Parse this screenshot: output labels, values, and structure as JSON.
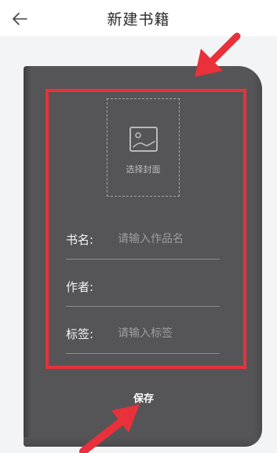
{
  "header": {
    "title": "新建书籍",
    "back_icon": "arrow-left-icon"
  },
  "cover": {
    "label": "选择封面",
    "icon": "image-icon"
  },
  "form": {
    "name": {
      "label": "书名:",
      "value": "",
      "placeholder": "请输入作品名"
    },
    "author": {
      "label": "作者:",
      "value": "",
      "placeholder": ""
    },
    "tags": {
      "label": "标签:",
      "value": "",
      "placeholder": "请输入标签"
    }
  },
  "save_label": "保存",
  "colors": {
    "book": "#555557",
    "annotation_red": "#e8313a",
    "background": "#f3f4f6"
  }
}
